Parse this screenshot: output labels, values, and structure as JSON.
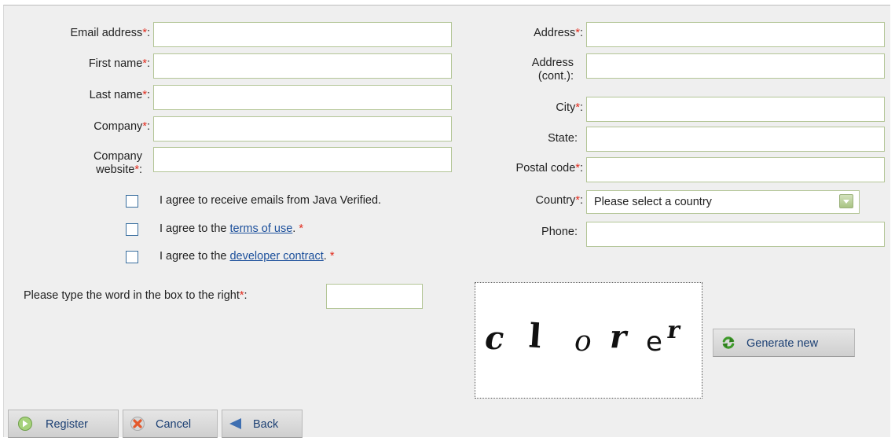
{
  "form": {
    "left_fields": [
      {
        "label": "Email address",
        "required": true,
        "value": ""
      },
      {
        "label": "First name",
        "required": true,
        "value": ""
      },
      {
        "label": "Last name",
        "required": true,
        "value": ""
      },
      {
        "label": "Company",
        "required": true,
        "value": ""
      },
      {
        "label_line1": "Company",
        "label_line2": "website",
        "required": true,
        "value": ""
      }
    ],
    "right_fields": [
      {
        "label": "Address",
        "required": true,
        "value": ""
      },
      {
        "label_line1": "Address",
        "label_line2": "(cont.):",
        "required": false,
        "value": ""
      },
      {
        "label": "City",
        "required": true,
        "value": ""
      },
      {
        "label": "State:",
        "required": false,
        "value": ""
      },
      {
        "label": "Postal code",
        "required": true,
        "value": ""
      },
      {
        "label": "Country",
        "required": true,
        "value": "Please select a country"
      },
      {
        "label": "Phone:",
        "required": false,
        "value": ""
      }
    ],
    "required_marker": "*",
    "colon": ":",
    "checkboxes": [
      {
        "text": "I agree to receive emails from Java Verified.",
        "checked": false
      },
      {
        "prefix": "I agree to the ",
        "link": "terms of use",
        "suffix": ".",
        "required": true,
        "checked": false
      },
      {
        "prefix": "I agree to the ",
        "link": "developer contract",
        "suffix": ".",
        "required": true,
        "checked": false
      }
    ],
    "captcha": {
      "prompt": "Please type the word in the box to the right",
      "value": "",
      "image_text": [
        "c",
        "l",
        "o",
        "r",
        "e",
        "r"
      ],
      "generate_label": "Generate new"
    }
  },
  "buttons": {
    "register": "Register",
    "cancel": "Cancel",
    "back": "Back"
  },
  "colors": {
    "background": "#efefef",
    "input_border": "#b3c596",
    "required": "#e12a1c",
    "link": "#1b4f9b",
    "button_text": "#1b3f73"
  }
}
